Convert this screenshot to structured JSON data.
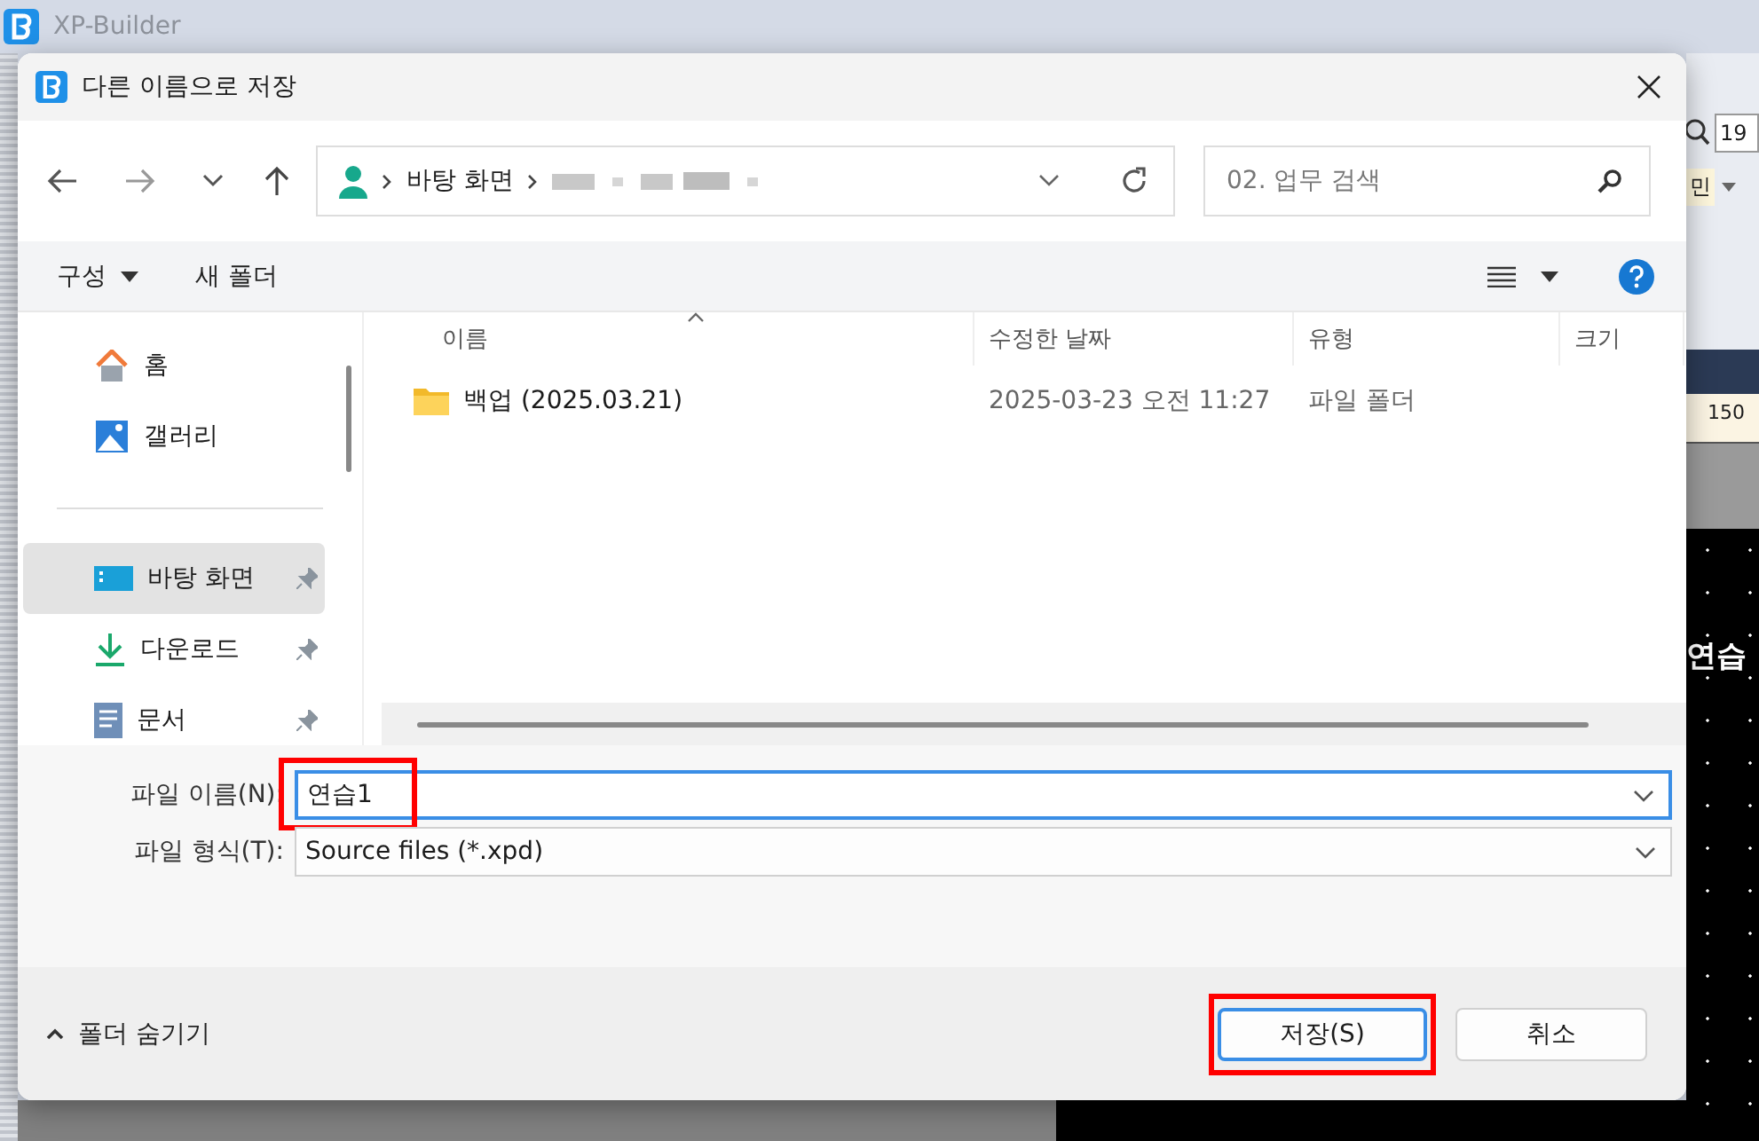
{
  "app": {
    "title": "XP-Builder",
    "zoom_value": "19",
    "font_value": "민",
    "ruler_label": "150",
    "canvas_text": "연습"
  },
  "dialog": {
    "title": "다른 이름으로 저장",
    "breadcrumb": [
      "바탕 화면"
    ],
    "search": {
      "placeholder": "02. 업무 검색"
    },
    "toolbar": {
      "organize": "구성",
      "new_folder": "새 폴더"
    },
    "sidebar": {
      "top": [
        {
          "label": "홈",
          "kind": "home",
          "pinned": false,
          "selected": false
        },
        {
          "label": "갤러리",
          "kind": "gallery",
          "pinned": false,
          "selected": false
        }
      ],
      "bottom": [
        {
          "label": "바탕 화면",
          "kind": "desktop",
          "pinned": true,
          "selected": true
        },
        {
          "label": "다운로드",
          "kind": "download",
          "pinned": true,
          "selected": false
        },
        {
          "label": "문서",
          "kind": "document",
          "pinned": true,
          "selected": false
        }
      ]
    },
    "columns": [
      {
        "label": "이름",
        "sorted": true
      },
      {
        "label": "수정한 날짜",
        "sorted": false
      },
      {
        "label": "유형",
        "sorted": false
      },
      {
        "label": "크기",
        "sorted": false
      }
    ],
    "rows": [
      {
        "name": "백업 (2025.03.21)",
        "modified": "2025-03-23 오전 11:27",
        "type": "파일 폴더"
      }
    ],
    "file_name": {
      "label": "파일 이름(N):",
      "value": "연습1",
      "highlighted": true
    },
    "file_type": {
      "label": "파일 형식(T):",
      "value": "Source files (*.xpd)"
    },
    "hide_folders": "폴더 숨기기",
    "buttons": [
      {
        "label": "저장(S)",
        "default": true,
        "highlighted": true
      },
      {
        "label": "취소",
        "default": false,
        "highlighted": false
      }
    ]
  }
}
